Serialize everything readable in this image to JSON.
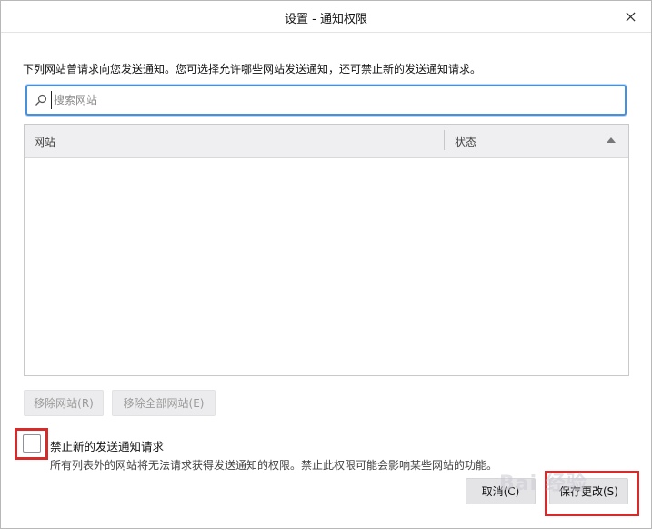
{
  "window": {
    "title": "设置 - 通知权限"
  },
  "description": "下列网站曾请求向您发送通知。您可选择允许哪些网站发送通知，还可禁止新的发送通知请求。",
  "search": {
    "placeholder": "搜索网站",
    "value": ""
  },
  "table": {
    "columns": [
      "网站",
      "状态"
    ],
    "rows": []
  },
  "buttons": {
    "remove_site": "移除网站(R)",
    "remove_all": "移除全部网站(E)",
    "cancel": "取消(C)",
    "save": "保存更改(S)"
  },
  "block_new": {
    "label": "禁止新的发送通知请求",
    "checked": false,
    "description": "所有列表外的网站将无法请求获得发送通知的权限。禁止此权限可能会影响某些网站的功能。"
  },
  "watermark": "Bai 经验",
  "colors": {
    "accent": "#4a90d9",
    "highlight": "#d62b2b"
  }
}
